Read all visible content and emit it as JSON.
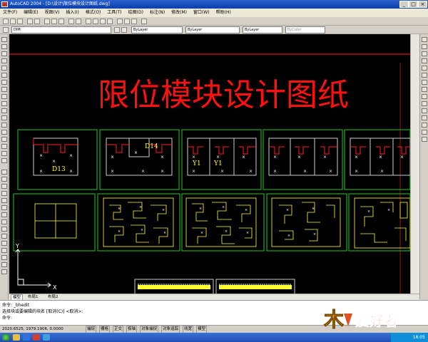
{
  "window": {
    "title": "AutoCAD 2004 - [D:\\设计\\限位模块设计图纸.dwg]"
  },
  "menu": [
    "文件(F)",
    "编辑(E)",
    "视图(V)",
    "插入(I)",
    "格式(O)",
    "工具(T)",
    "绘图(D)",
    "标注(N)",
    "修改(M)",
    "窗口(W)",
    "帮助(H)"
  ],
  "toolbar": {
    "layer_combo": "DIM",
    "color_combo": "ByLayer",
    "linetype_combo": "ByLayer",
    "lineweight_combo": "ByLayer",
    "plotstyle_combo": "ByColor"
  },
  "drawing": {
    "title": "限位模块设计图纸",
    "labels": [
      "D13",
      "D14",
      "Y1",
      "Y1"
    ],
    "axis_y": "Y",
    "axis_x": "X"
  },
  "tabs": [
    "模型",
    "布局1",
    "布局2"
  ],
  "command": {
    "line1": "命令: _bhedit",
    "line2": "选择块或要编辑的块名 [取消(C)] <取消>:",
    "prompt": "命令:"
  },
  "status": {
    "coords": "2020.6525, 1979.1906, 0.0000",
    "modes": [
      "捕捉",
      "栅格",
      "正交",
      "极轴",
      "对象捕捉",
      "对象追踪",
      "线宽",
      "模型"
    ]
  },
  "taskbar": {
    "time": "18:05"
  },
  "watermark": {
    "text": "爱好者"
  },
  "colors": {
    "canvas": "#000000",
    "title_red": "#ff1010",
    "frame_green": "#22cc22",
    "yellow": "#ffff30",
    "red": "#ff2020"
  }
}
